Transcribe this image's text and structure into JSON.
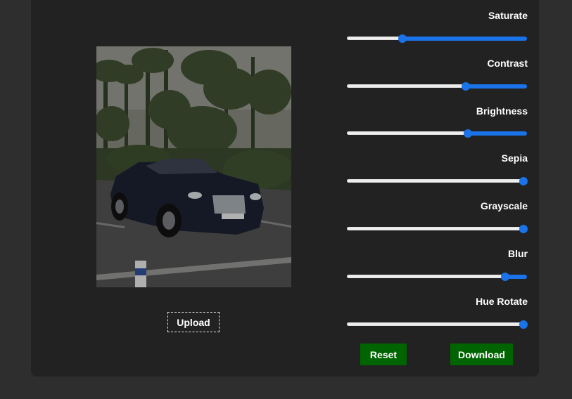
{
  "upload": {
    "label": "Upload"
  },
  "sliders": [
    {
      "label": "Saturate",
      "fraction": 0.31
    },
    {
      "label": "Contrast",
      "fraction": 0.66
    },
    {
      "label": "Brightness",
      "fraction": 0.67
    },
    {
      "label": "Sepia",
      "fraction": 0.98
    },
    {
      "label": "Grayscale",
      "fraction": 0.98
    },
    {
      "label": "Blur",
      "fraction": 0.88
    },
    {
      "label": "Hue Rotate",
      "fraction": 0.98
    }
  ],
  "buttons": {
    "reset": "Reset",
    "download": "Download"
  },
  "colors": {
    "accent": "#1a73e8",
    "button": "#006400",
    "panel": "#222222",
    "background": "#2e2e2e"
  }
}
